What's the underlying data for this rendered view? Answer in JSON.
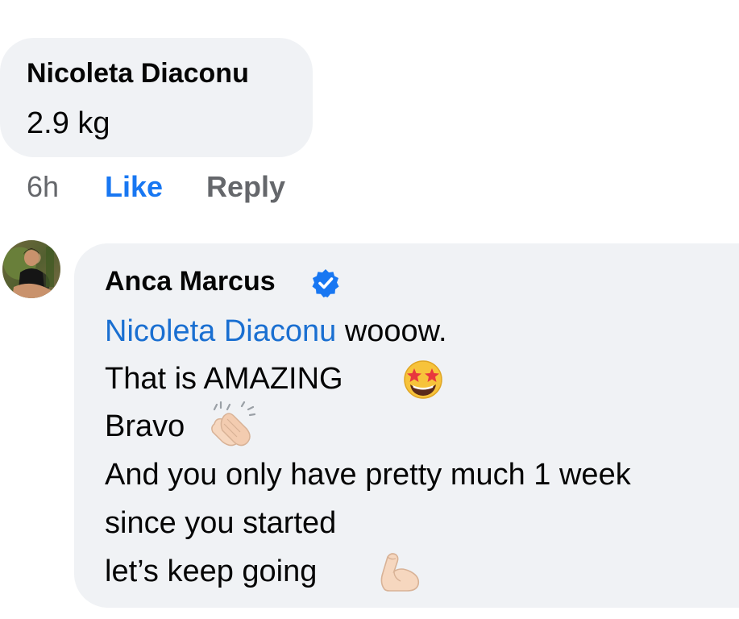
{
  "comment1": {
    "author": "Nicoleta Diaconu",
    "text": "2.9 kg",
    "time": "6h",
    "like_label": "Like",
    "reply_label": "Reply"
  },
  "comment2": {
    "author": "Anca Marcus",
    "verified_icon": "verified-badge-icon",
    "mention": "Nicoleta Diaconu",
    "line1_rest": " wooow.",
    "line2": "That is AMAZING",
    "line2_emoji": "star-struck-emoji",
    "line3": "Bravo",
    "line3_emoji": "clapping-hands-emoji",
    "line4": "And you only have pretty much 1 week",
    "line5": "since you started",
    "line6": "let’s keep going",
    "line6_emoji": "flexed-biceps-emoji"
  },
  "colors": {
    "bubble": "#f0f2f5",
    "link_blue": "#1877f2",
    "mention_blue": "#1a6fd1",
    "meta_gray": "#65676b"
  }
}
